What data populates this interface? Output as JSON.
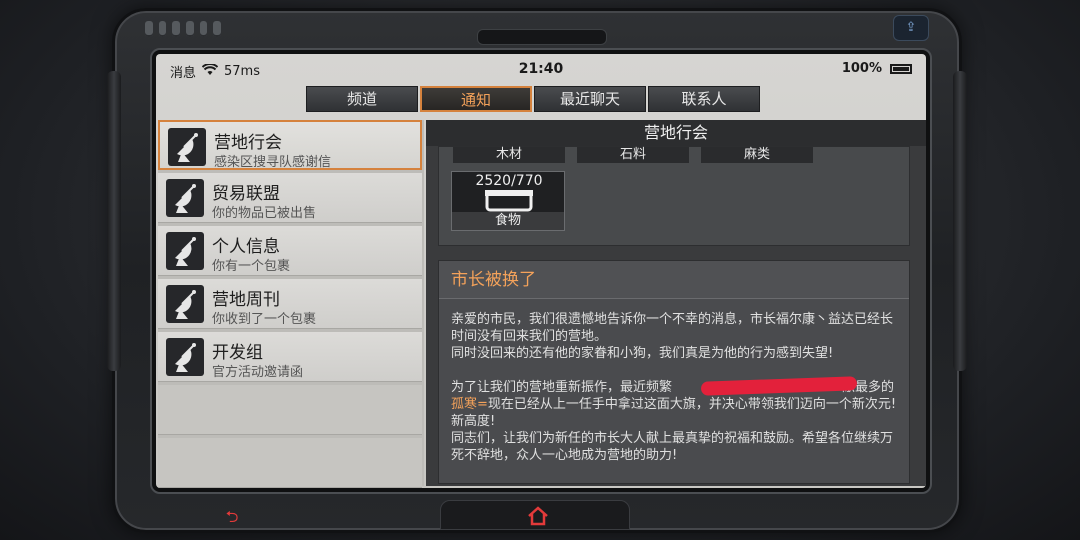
{
  "statusbar": {
    "left_label": "消息",
    "signal": "57ms",
    "time": "21:40",
    "battery": "100%"
  },
  "tabs": [
    {
      "label": "频道",
      "active": false
    },
    {
      "label": "通知",
      "active": true
    },
    {
      "label": "最近聊天",
      "active": false
    },
    {
      "label": "联系人",
      "active": false
    }
  ],
  "list": [
    {
      "title": "营地行会",
      "subtitle": "感染区搜寻队感谢信",
      "selected": true
    },
    {
      "title": "贸易联盟",
      "subtitle": "你的物品已被出售",
      "selected": false
    },
    {
      "title": "个人信息",
      "subtitle": "你有一个包裹",
      "selected": false
    },
    {
      "title": "营地周刊",
      "subtitle": "你收到了一个包裹",
      "selected": false
    },
    {
      "title": "开发组",
      "subtitle": "官方活动邀请函",
      "selected": false
    }
  ],
  "panel": {
    "header": "营地行会",
    "resource_labels": [
      "木材",
      "石料",
      "麻类"
    ],
    "resource_item": {
      "count": "2520/770",
      "name": "食物"
    },
    "message": {
      "title": "市长被换了",
      "p1": "亲爱的市民，我们很遗憾地告诉你一个不幸的消息，市长福尔康丶益达已经长时间没有回来我们的营地。",
      "p2": "同时没回来的还有他的家眷和小狗，我们真是为他的行为感到失望!",
      "p3a": "为了让我们的营地重新振作，最近频繁",
      "p3b": "献最多的",
      "p3c": "孤寒=",
      "p3d": "现在已经从上一任手中拿过这面大旗，并决心带领我们迈向一个新次元! 新高度!",
      "p4": "同志们，让我们为新任的市长大人献上最真挚的祝福和鼓励。希望各位继续万死不辞地，众人一心地成为营地的助力!"
    }
  },
  "colors": {
    "accent": "#d5823d",
    "redaction": "#e3213b"
  }
}
